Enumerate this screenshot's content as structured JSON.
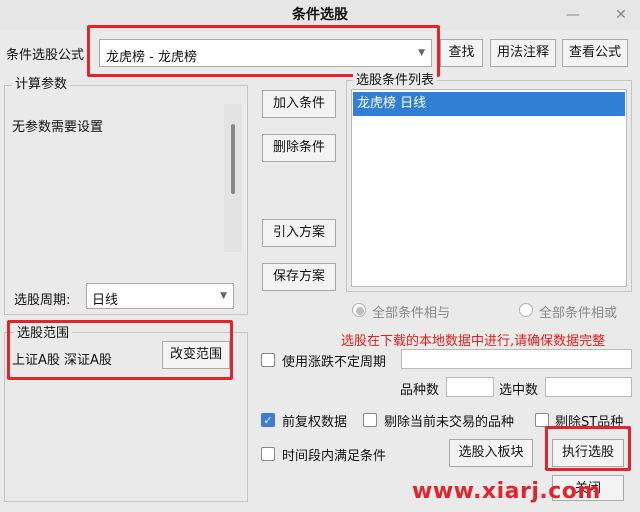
{
  "window": {
    "title": "条件选股",
    "minimize": "—",
    "close": "✕"
  },
  "formula": {
    "label": "条件选股公式",
    "value": "龙虎榜        - 龙虎榜"
  },
  "top_buttons": {
    "find": "查找",
    "usage": "用法注释",
    "view": "查看公式"
  },
  "params": {
    "legend": "计算参数",
    "text": "无参数需要设置",
    "period_label": "选股周期:",
    "period_value": "日线"
  },
  "scope": {
    "legend": "选股范围",
    "text": "上证A股 深证A股",
    "change_btn": "改变范围"
  },
  "middle_buttons": {
    "add": "加入条件",
    "delete": "删除条件",
    "import": "引入方案",
    "save": "保存方案"
  },
  "conditions": {
    "legend": "选股条件列表",
    "items": [
      "龙虎榜  日线"
    ]
  },
  "logic": {
    "and": "全部条件相与",
    "or": "全部条件相或"
  },
  "warning": "选股在下载的本地数据中进行,请确保数据完整",
  "options": {
    "irregular_period": "使用涨跌不定周期",
    "stock_count_label": "品种数",
    "selected_count_label": "选中数",
    "pre_adjust": "前复权数据",
    "exclude_untraded": "剔除当前未交易的品种",
    "exclude_st": "剔除ST品种",
    "time_range": "时间段内满足条件"
  },
  "bottom_buttons": {
    "to_block": "选股入板块",
    "execute": "执行选股",
    "close": "关闭"
  },
  "watermark": "www.xiarj.com",
  "colors": {
    "highlight": "#e0262c",
    "selection": "#2f7fd6",
    "warning": "#e02020"
  }
}
